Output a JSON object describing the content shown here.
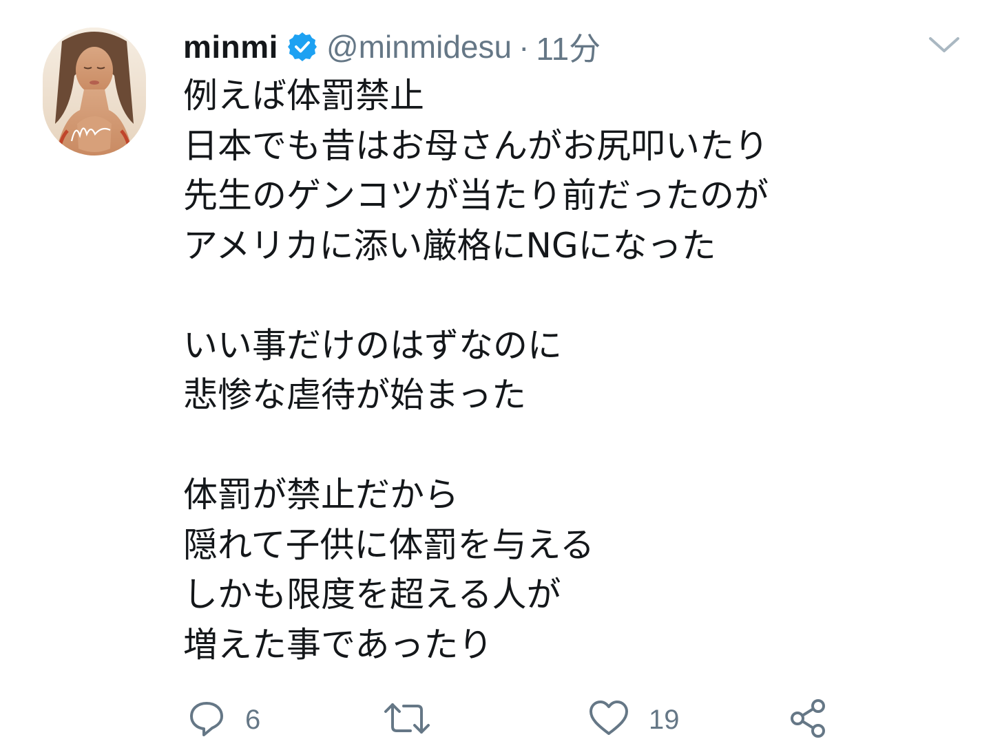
{
  "tweet": {
    "author": {
      "display_name": "minmi",
      "handle": "@minmidesu",
      "verified": true,
      "avatar_signature": "Min"
    },
    "separator": "·",
    "timestamp": "11分",
    "lines": [
      "例えば体罰禁止",
      "日本でも昔はお母さんがお尻叩いたり",
      "先生のゲンコツが当たり前だったのが",
      "アメリカに添い厳格にNGになった",
      "",
      "いい事だけのはずなのに",
      "悲惨な虐待が始まった",
      "",
      "体罰が禁止だから",
      "隠れて子供に体罰を与える",
      "しかも限度を超える人が",
      "増えた事であったり"
    ],
    "actions": {
      "reply": {
        "icon": "reply-icon",
        "count": "6"
      },
      "retweet": {
        "icon": "retweet-icon",
        "count": ""
      },
      "like": {
        "icon": "heart-icon",
        "count": "19"
      },
      "share": {
        "icon": "share-icon"
      }
    }
  },
  "colors": {
    "text": "#14171a",
    "muted": "#657786",
    "verified": "#1da1f2",
    "icon": "#657786"
  }
}
